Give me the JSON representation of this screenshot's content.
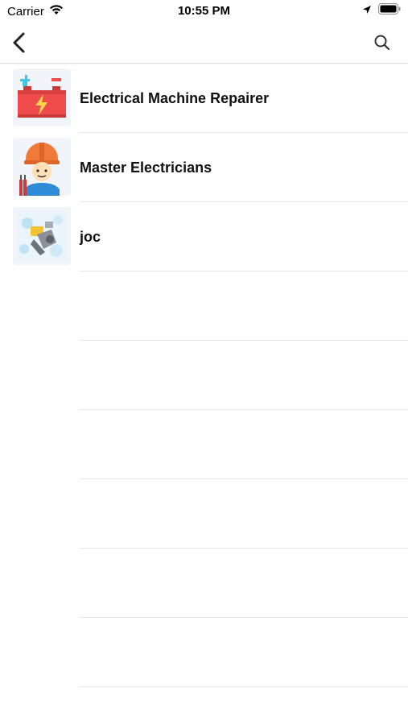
{
  "status_bar": {
    "carrier": "Carrier",
    "time": "10:55 PM",
    "icons": [
      "wifi-icon",
      "location-arrow-icon",
      "battery-icon"
    ]
  },
  "nav": {
    "back_icon": "chevron-left-icon",
    "search_icon": "search-icon"
  },
  "list": {
    "items": [
      {
        "title": "Electrical Machine Repairer",
        "icon": "battery-charge-icon"
      },
      {
        "title": "Master Electricians",
        "icon": "electrician-worker-icon"
      },
      {
        "title": "joc",
        "icon": "machine-photo-icon"
      }
    ]
  },
  "colors": {
    "battery_body": "#ef4b4b",
    "battery_plus": "#3fc7e8",
    "helmet": "#f07a3a",
    "shirt": "#2f8ad8",
    "separator": "#e8e8e8"
  }
}
